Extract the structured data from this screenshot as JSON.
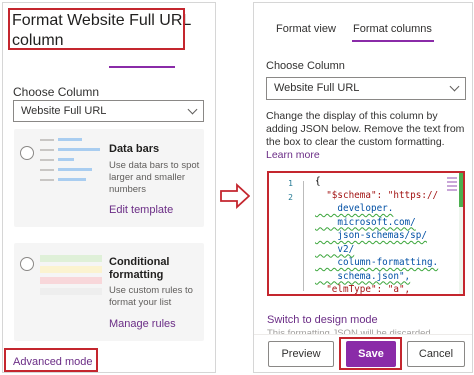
{
  "left": {
    "title": "Format Website Full URL column",
    "choose_label": "Choose Column",
    "column_value": "Website Full URL",
    "cards": [
      {
        "title": "Data bars",
        "desc": "Use data bars to spot larger and smaller numbers",
        "link": "Edit template"
      },
      {
        "title": "Conditional formatting",
        "desc": "Use custom rules to format your list",
        "link": "Manage rules"
      }
    ],
    "advanced_link": "Advanced mode"
  },
  "right": {
    "tabs": [
      "Format view",
      "Format columns"
    ],
    "active_tab": "Format columns",
    "choose_label": "Choose Column",
    "column_value": "Website Full URL",
    "description": "Change the display of this column by adding JSON below. Remove the text from the box to clear the custom formatting.",
    "learn_more": "Learn more",
    "editor": {
      "line_numbers": [
        "1",
        "2"
      ],
      "lines": [
        "{",
        "  \"$schema\": \"https://",
        "    developer.",
        "    microsoft.com/",
        "    json-schemas/sp/",
        "    v2/",
        "    column-formatting.",
        "    schema.json\",",
        "  \"elmType\": \"a\","
      ]
    },
    "switch_link": "Switch to design mode",
    "faded_note": "This formatting JSON will be discarded",
    "buttons": {
      "preview": "Preview",
      "save": "Save",
      "cancel": "Cancel"
    }
  },
  "colors": {
    "accent": "#8a2ba8",
    "highlight": "#c4262e",
    "link": "#6b2d86"
  }
}
